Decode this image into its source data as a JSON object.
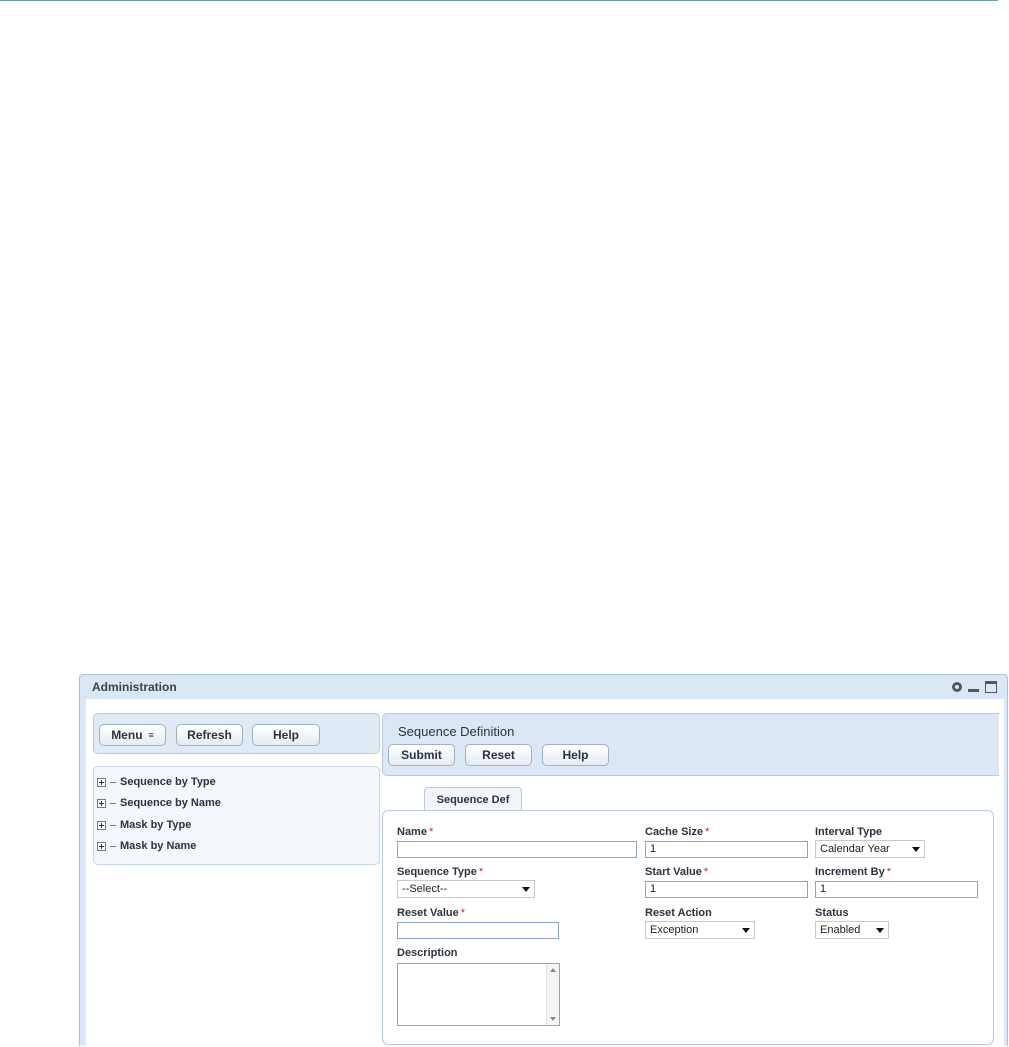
{
  "window": {
    "title": "Administration",
    "icons": [
      "gear-icon",
      "minimize-icon",
      "maximize-icon"
    ]
  },
  "left_toolbar": {
    "menu_label": "Menu",
    "refresh_label": "Refresh",
    "help_label": "Help"
  },
  "tree": {
    "items": [
      {
        "label": "Sequence by Type",
        "icon": "expand-icon"
      },
      {
        "label": "Sequence by Name",
        "icon": "expand-icon"
      },
      {
        "label": "Mask by Type",
        "icon": "expand-icon"
      },
      {
        "label": "Mask by Name",
        "icon": "expand-icon"
      }
    ]
  },
  "section": {
    "title": "Sequence Definition",
    "submit_label": "Submit",
    "reset_label": "Reset",
    "help_label": "Help"
  },
  "tabs": [
    {
      "label": "Sequence Def",
      "active": true
    }
  ],
  "form": {
    "name": {
      "label": "Name",
      "required": "*",
      "value": ""
    },
    "cache_size": {
      "label": "Cache Size",
      "required": "*",
      "value": "1"
    },
    "interval_type": {
      "label": "Interval Type",
      "selected": "Calendar Year"
    },
    "sequence_type": {
      "label": "Sequence Type",
      "required": "*",
      "selected": "--Select--"
    },
    "start_value": {
      "label": "Start Value",
      "required": "*",
      "value": "1"
    },
    "increment_by": {
      "label": "Increment By",
      "required": "*",
      "value": "1"
    },
    "reset_value": {
      "label": "Reset Value",
      "required": "*",
      "value": ""
    },
    "reset_action": {
      "label": "Reset Action",
      "selected": "Exception"
    },
    "status": {
      "label": "Status",
      "selected": "Enabled"
    },
    "description": {
      "label": "Description",
      "value": ""
    }
  },
  "colors": {
    "portlet_bg": "#d9e7f6",
    "required": "#d2232a",
    "field_border": "#8ba7c4"
  }
}
